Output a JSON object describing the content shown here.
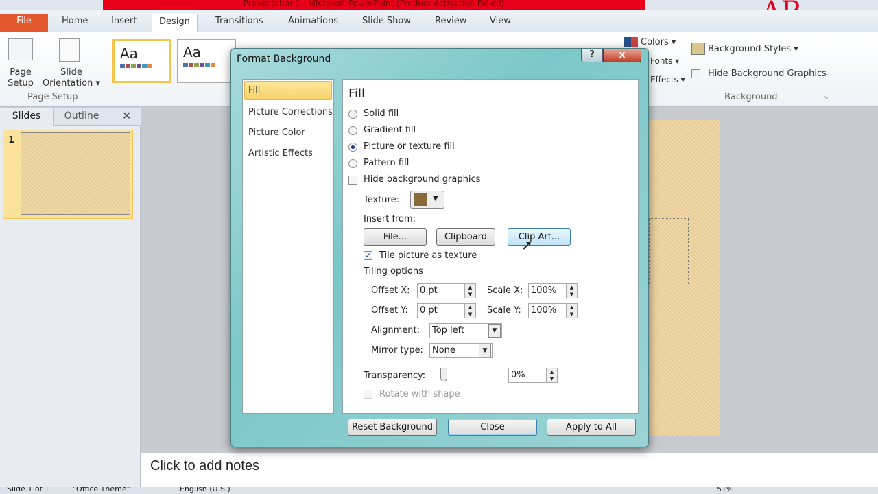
{
  "window": {
    "title": "Presentation1 - Microsoft PowerPoint (Product Activation Failed)",
    "watermark": "AR."
  },
  "tabs": [
    {
      "label": "File"
    },
    {
      "label": "Home"
    },
    {
      "label": "Insert"
    },
    {
      "label": "Design",
      "active": true
    },
    {
      "label": "Transitions"
    },
    {
      "label": "Animations"
    },
    {
      "label": "Slide Show"
    },
    {
      "label": "Review"
    },
    {
      "label": "View"
    }
  ],
  "ribbon": {
    "page_setup": "Page Setup",
    "slide_orientation": "Slide Orientation",
    "page_setup_group": "Page Setup",
    "theme_sample": "Aa",
    "colors": "Colors",
    "fonts": "Fonts",
    "effects": "Effects",
    "background_styles": "Background Styles",
    "hide_bg_graphics": "Hide Background Graphics",
    "background_group": "Background"
  },
  "slides_panel": {
    "tabs": [
      "Slides",
      "Outline"
    ],
    "slide_number": "1"
  },
  "notes": {
    "placeholder": "Click to add notes"
  },
  "status": {
    "slide": "Slide 1 of 1",
    "theme": "\"Office Theme\"",
    "language": "English (U.S.)",
    "zoom": "51%"
  },
  "dialog": {
    "title": "Format Background",
    "help": "?",
    "close": "x",
    "categories": [
      "Fill",
      "Picture Corrections",
      "Picture Color",
      "Artistic Effects"
    ],
    "selected_category": "Fill",
    "section_title": "Fill",
    "fill_options": [
      {
        "label": "Solid fill",
        "checked": false
      },
      {
        "label": "Gradient fill",
        "checked": false
      },
      {
        "label": "Picture or texture fill",
        "checked": true
      },
      {
        "label": "Pattern fill",
        "checked": false
      }
    ],
    "hide_bg_graphics": {
      "label": "Hide background graphics",
      "checked": false
    },
    "texture_label": "Texture:",
    "insert_from": "Insert from:",
    "buttons_insert": [
      "File...",
      "Clipboard",
      "Clip Art..."
    ],
    "tile": {
      "label": "Tile picture as texture",
      "checked": true
    },
    "tiling_options": "Tiling options",
    "offset_x": {
      "label": "Offset X:",
      "value": "0 pt"
    },
    "offset_y": {
      "label": "Offset Y:",
      "value": "0 pt"
    },
    "scale_x": {
      "label": "Scale X:",
      "value": "100%"
    },
    "scale_y": {
      "label": "Scale Y:",
      "value": "100%"
    },
    "alignment": {
      "label": "Alignment:",
      "value": "Top left"
    },
    "mirror": {
      "label": "Mirror type:",
      "value": "None"
    },
    "transparency": {
      "label": "Transparency:",
      "value": "0%",
      "percent": 0
    },
    "rotate": {
      "label": "Rotate with shape",
      "checked": false,
      "disabled": true
    },
    "footer": {
      "reset": "Reset Background",
      "close": "Close",
      "apply_all": "Apply to All"
    }
  },
  "colors": {
    "file_tab": "#e2572b",
    "title_red": "#e8001a",
    "selection": "#f4c54a",
    "dialog_frame": "#7cc7c9"
  }
}
